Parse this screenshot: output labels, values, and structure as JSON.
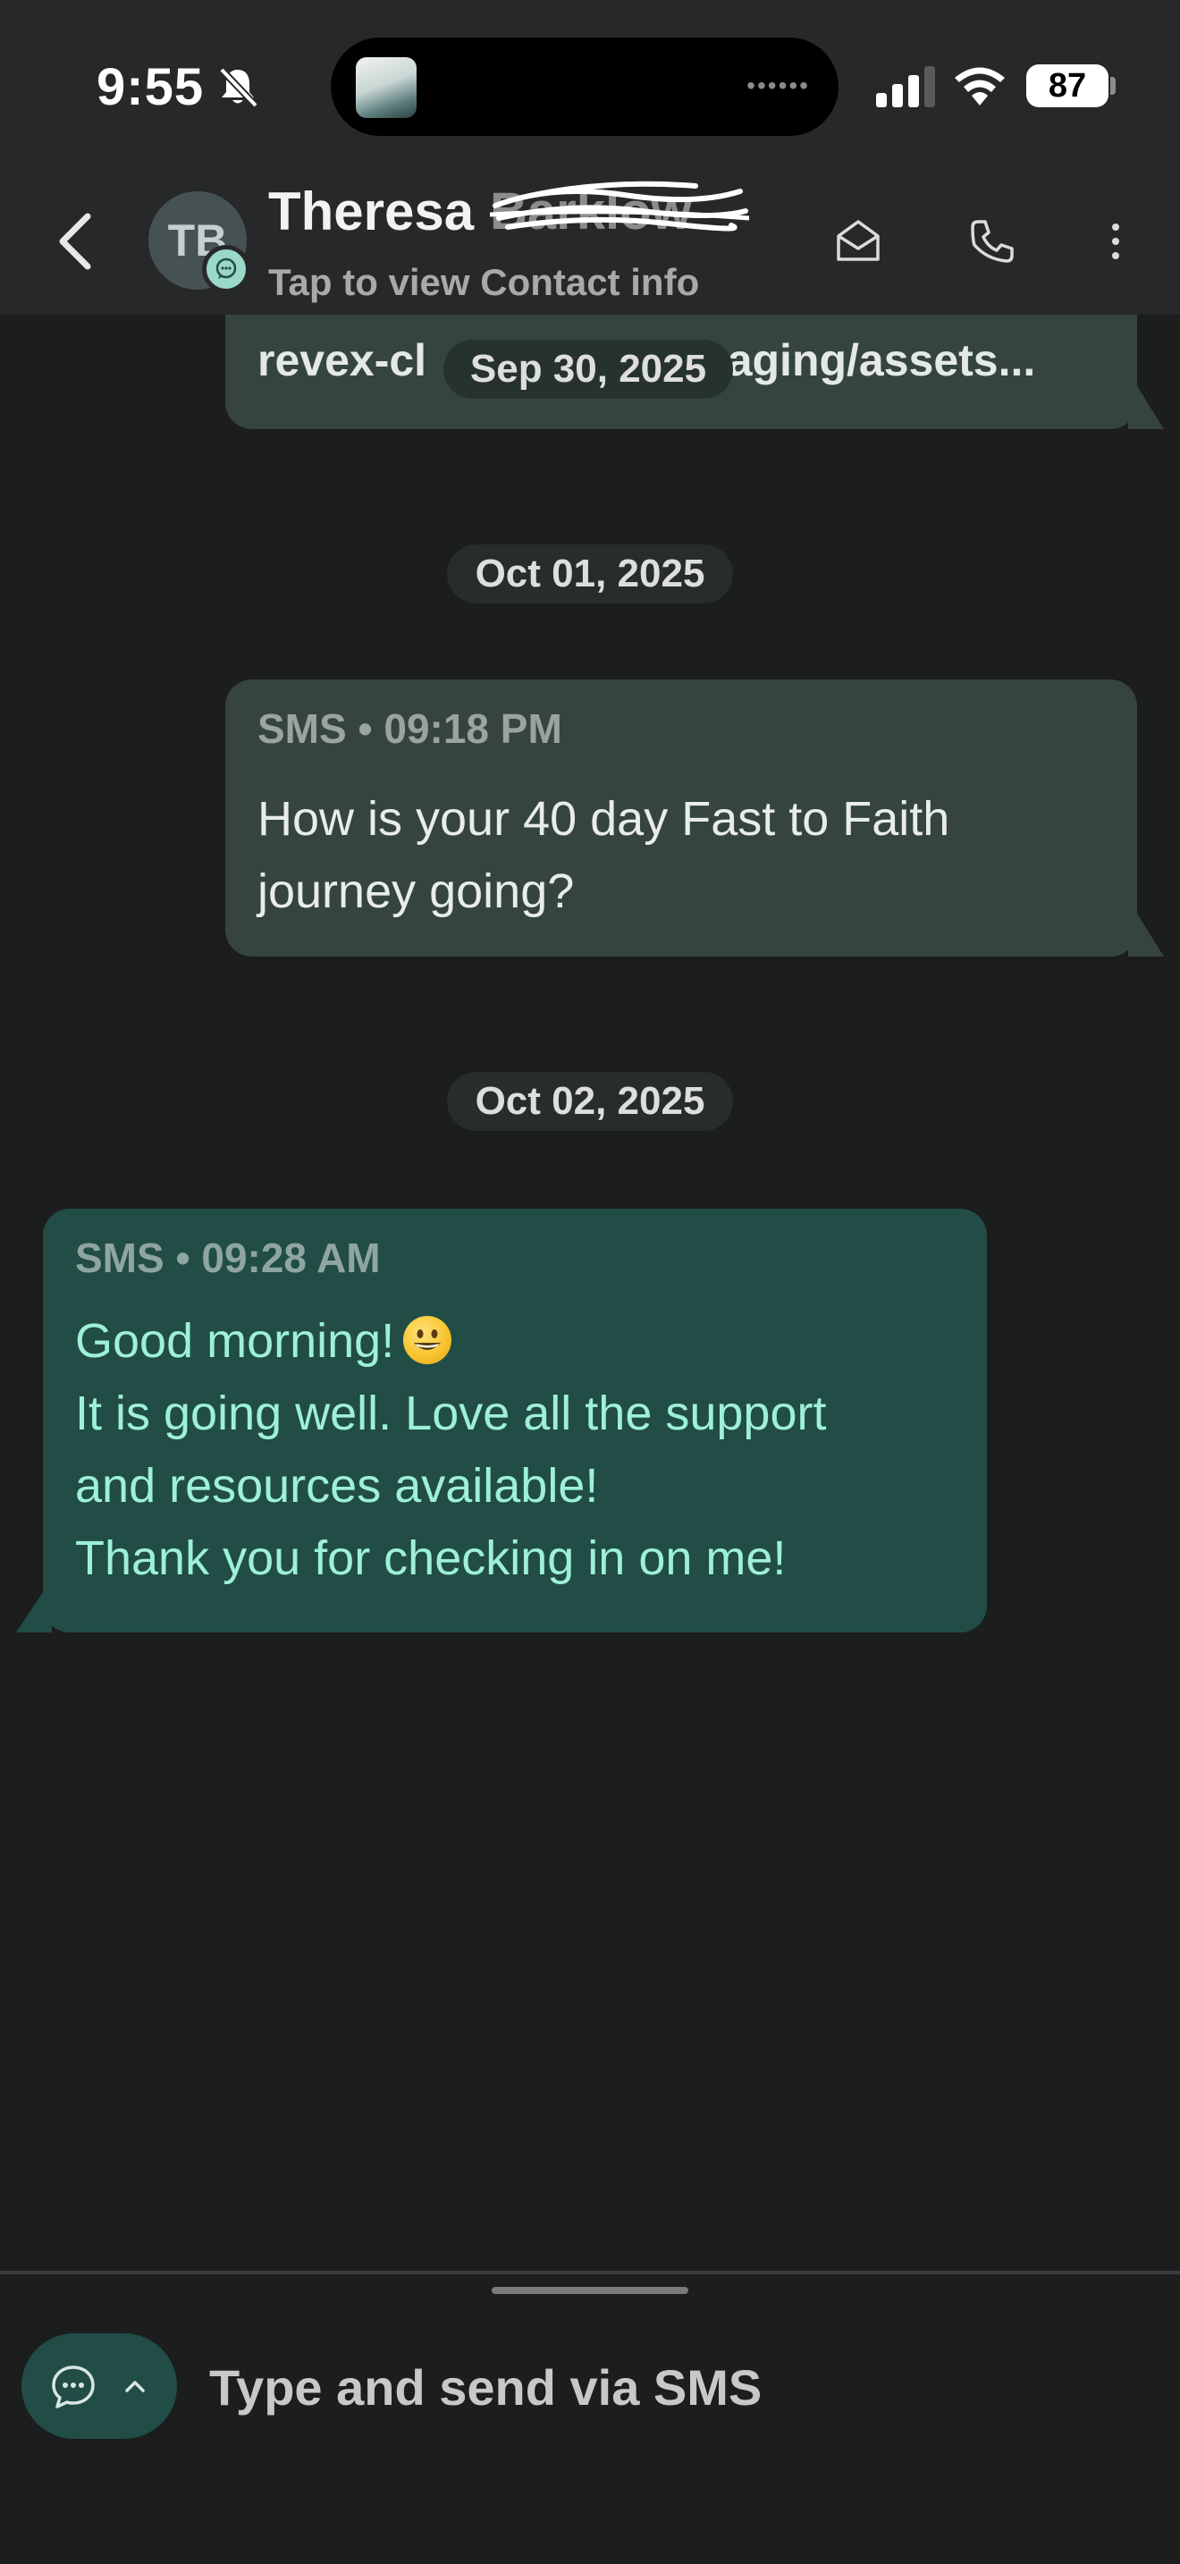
{
  "status_bar": {
    "time": "9:55",
    "battery": "87",
    "icons": [
      "bell-slash-icon",
      "signal-icon",
      "wifi-icon",
      "battery-icon"
    ]
  },
  "header": {
    "avatar_initials": "TB",
    "contact_name": "Theresa",
    "subtitle": "Tap to view Contact info",
    "actions": [
      "email-icon",
      "phone-icon",
      "more-vertical-icon"
    ]
  },
  "thread": {
    "previous_message_link": "revex-cli[…]taging/assets...",
    "date_separators": [
      "Sep 30, 2025",
      "Oct 01, 2025",
      "Oct 02, 2025"
    ],
    "messages": [
      {
        "direction": "outgoing",
        "channel": "SMS",
        "time": "09:18 PM",
        "lines": [
          "How is your 40 day Fast to Faith",
          "journey going?"
        ]
      },
      {
        "direction": "incoming",
        "channel": "SMS",
        "time": "09:28 AM",
        "lines": [
          "Good morning!",
          "It is going well. Love all the support",
          "and resources available!",
          "Thank you for checking in on me!"
        ],
        "emoji": "grinning-face"
      }
    ]
  },
  "composer": {
    "placeholder": "Type and send via SMS"
  },
  "colors": {
    "background": "#1c1d1d",
    "header": "#272829",
    "outgoing_bubble": "#354441",
    "incoming_bubble": "#214d46",
    "incoming_text": "#9ef0d6"
  }
}
